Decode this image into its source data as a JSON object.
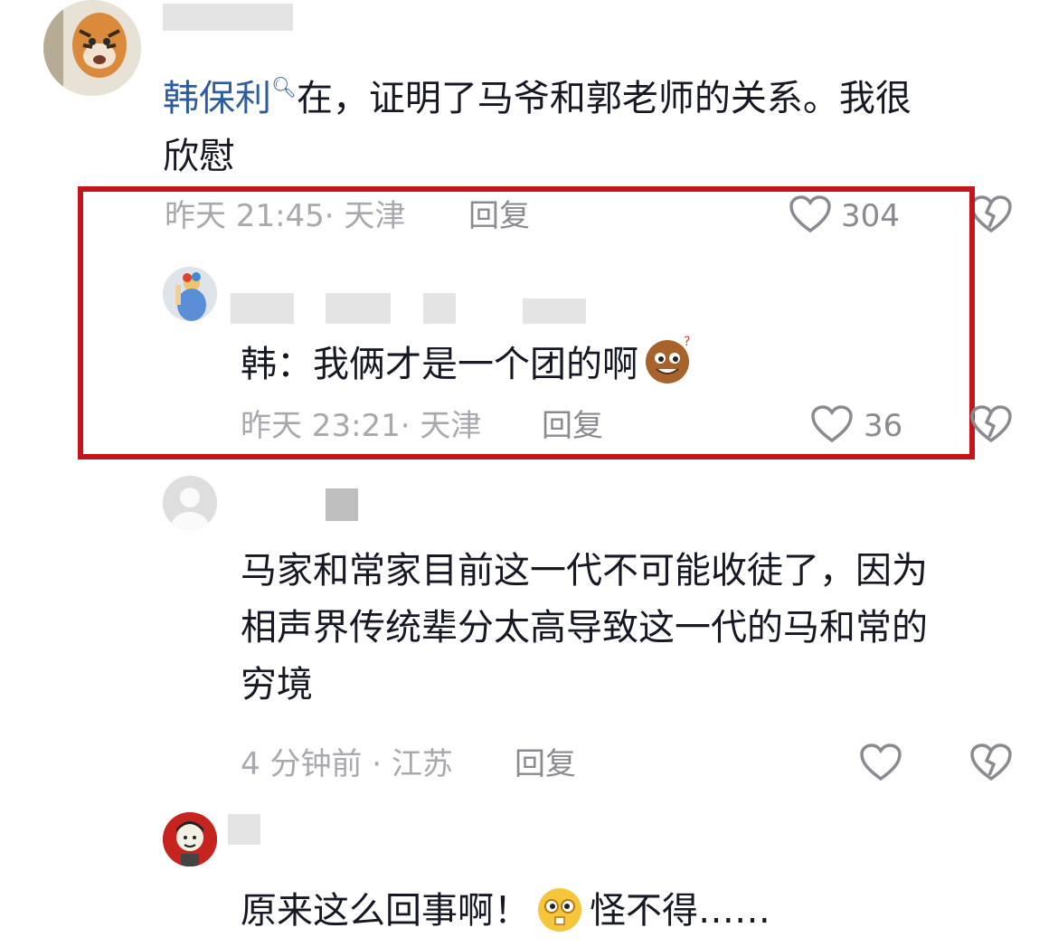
{
  "comment1": {
    "mention": "韩保利",
    "text_line1": "在，证明了马爷和郭老师的关系。我很",
    "text_line2": "欣慰",
    "time_location": "昨天 21:45· 天津",
    "reply_label": "回复",
    "like_count": "304"
  },
  "reply1": {
    "text": "韩：我俩才是一个团的啊",
    "time_location": "昨天 23:21· 天津",
    "reply_label": "回复",
    "like_count": "36"
  },
  "reply2": {
    "text_line1": "马家和常家目前这一代不可能收徒了，因为",
    "text_line2": "相声界传统辈分太高导致这一代的马和常的",
    "text_line3": "穷境",
    "time_location": "4 分钟前 · 江苏",
    "reply_label": "回复"
  },
  "reply3": {
    "text_a": "原来这么回事啊！",
    "text_b": "怪不得……"
  },
  "colors": {
    "highlight_border": "#c2161b",
    "mention": "#2e5c9c",
    "meta_text": "#a8a9ae",
    "icon_gray": "#8a8b91"
  },
  "icons": [
    "search-icon",
    "heart-icon",
    "broken-heart-icon",
    "emoji-icon"
  ]
}
